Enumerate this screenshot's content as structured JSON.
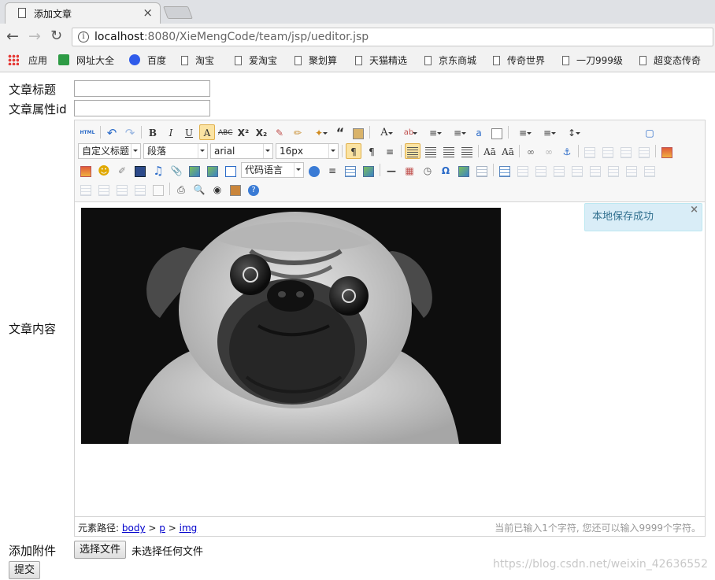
{
  "browser": {
    "tab_title": "添加文章",
    "tab_close": "×",
    "url_host": "localhost",
    "url_rest": ":8080/XieMengCode/team/jsp/ueditor.jsp"
  },
  "bookmarks": [
    "应用",
    "网址大全",
    "百度",
    "淘宝",
    "爱淘宝",
    "聚划算",
    "天猫精选",
    "京东商城",
    "传奇世界",
    "一刀999级",
    "超变态传奇"
  ],
  "form": {
    "title_label": "文章标题",
    "attr_label": "文章属性id",
    "content_label": "文章内容",
    "attach_label": "添加附件",
    "title_value": "",
    "attr_value": "",
    "choose_file_button": "选择文件",
    "no_file_text": "未选择任何文件",
    "submit_button": "提交"
  },
  "editor": {
    "html_button": "HTML",
    "custom_title_select": "自定义标题",
    "paragraph_select": "段落",
    "font_select": "arial",
    "size_select": "16px",
    "code_lang_select": "代码语言",
    "toast_text": "本地保存成功",
    "toast_close": "×",
    "path_label": "元素路径:",
    "path_items": [
      "body",
      "p",
      "img"
    ],
    "path_sep": ">",
    "char_count": "当前已输入1个字符, 您还可以输入9999个字符。"
  },
  "watermark": "https://blog.csdn.net/weixin_42636552",
  "colors": {
    "toast_bg": "#d9edf7",
    "toast_text": "#31708f",
    "link": "#0000cc",
    "active_btn": "#fbe3a2"
  }
}
